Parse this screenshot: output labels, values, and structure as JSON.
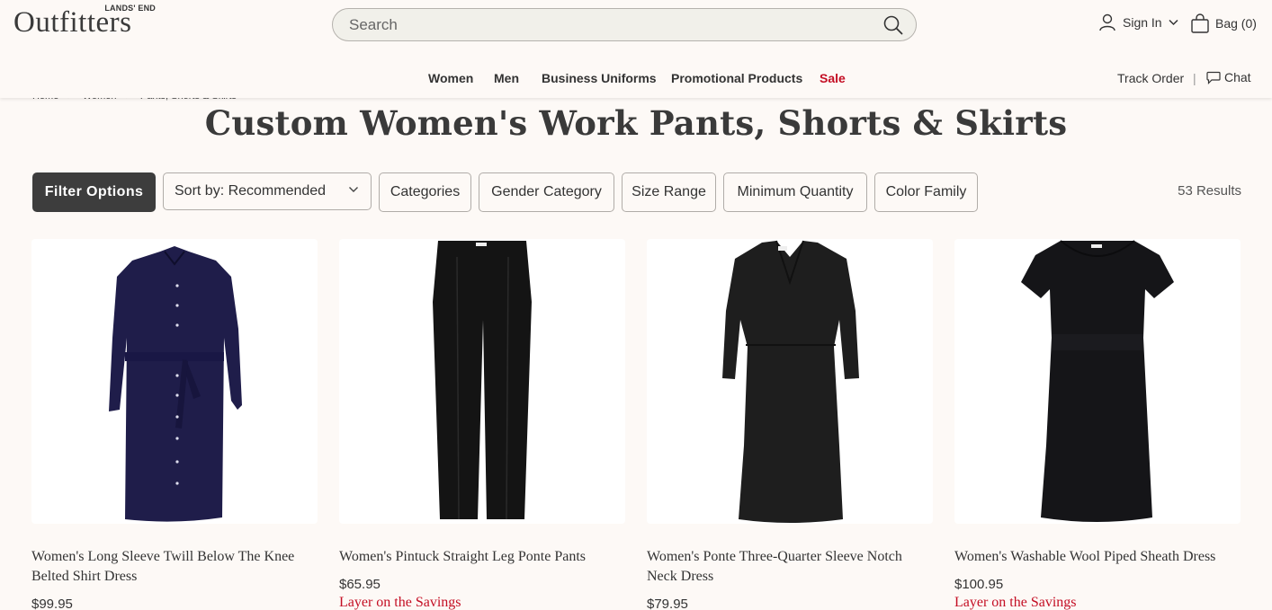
{
  "header": {
    "logo_small": "LANDS' END",
    "logo_main": "Outfitters",
    "search_placeholder": "Search",
    "sign_in": "Sign In",
    "bag": "Bag (0)"
  },
  "nav": {
    "items": [
      "Women",
      "Men",
      "Business Uniforms",
      "Promotional Products",
      "Sale"
    ],
    "track_order": "Track Order",
    "separator": "|",
    "chat": "Chat"
  },
  "breadcrumb": [
    "Home",
    ">",
    "Women",
    ">",
    "Pants, Shorts & Skirts"
  ],
  "page": {
    "title": "Custom Women's Work Pants, Shorts & Skirts"
  },
  "filters": {
    "filter_options": "Filter Options",
    "sort_label": "Sort by: Recommended",
    "chips": [
      "Categories",
      "Gender Category",
      "Size Range",
      "Minimum Quantity",
      "Color Family"
    ],
    "results": "53 Results"
  },
  "products": [
    {
      "name": "Women's Long Sleeve Twill Below The Knee Belted Shirt Dress",
      "price": "$99.95",
      "promo": "",
      "color": "#1f1d4a",
      "icon": "shirt-dress"
    },
    {
      "name": "Women's Pintuck Straight Leg Ponte Pants",
      "price": "$65.95",
      "promo": "Layer on the Savings",
      "color": "#141414",
      "icon": "pants"
    },
    {
      "name": "Women's Ponte Three-Quarter Sleeve Notch Neck Dress",
      "price": "$79.95",
      "promo": "",
      "color": "#1e1e1e",
      "icon": "sheath-dress"
    },
    {
      "name": "Women's Washable Wool Piped Sheath Dress",
      "price": "$100.95",
      "promo": "Layer on the Savings",
      "color": "#151518",
      "icon": "short-sleeve-dress"
    }
  ],
  "colors": {
    "sale": "#c40e24",
    "filter_button": "#3d3d3d",
    "background": "#fdf9f6"
  }
}
